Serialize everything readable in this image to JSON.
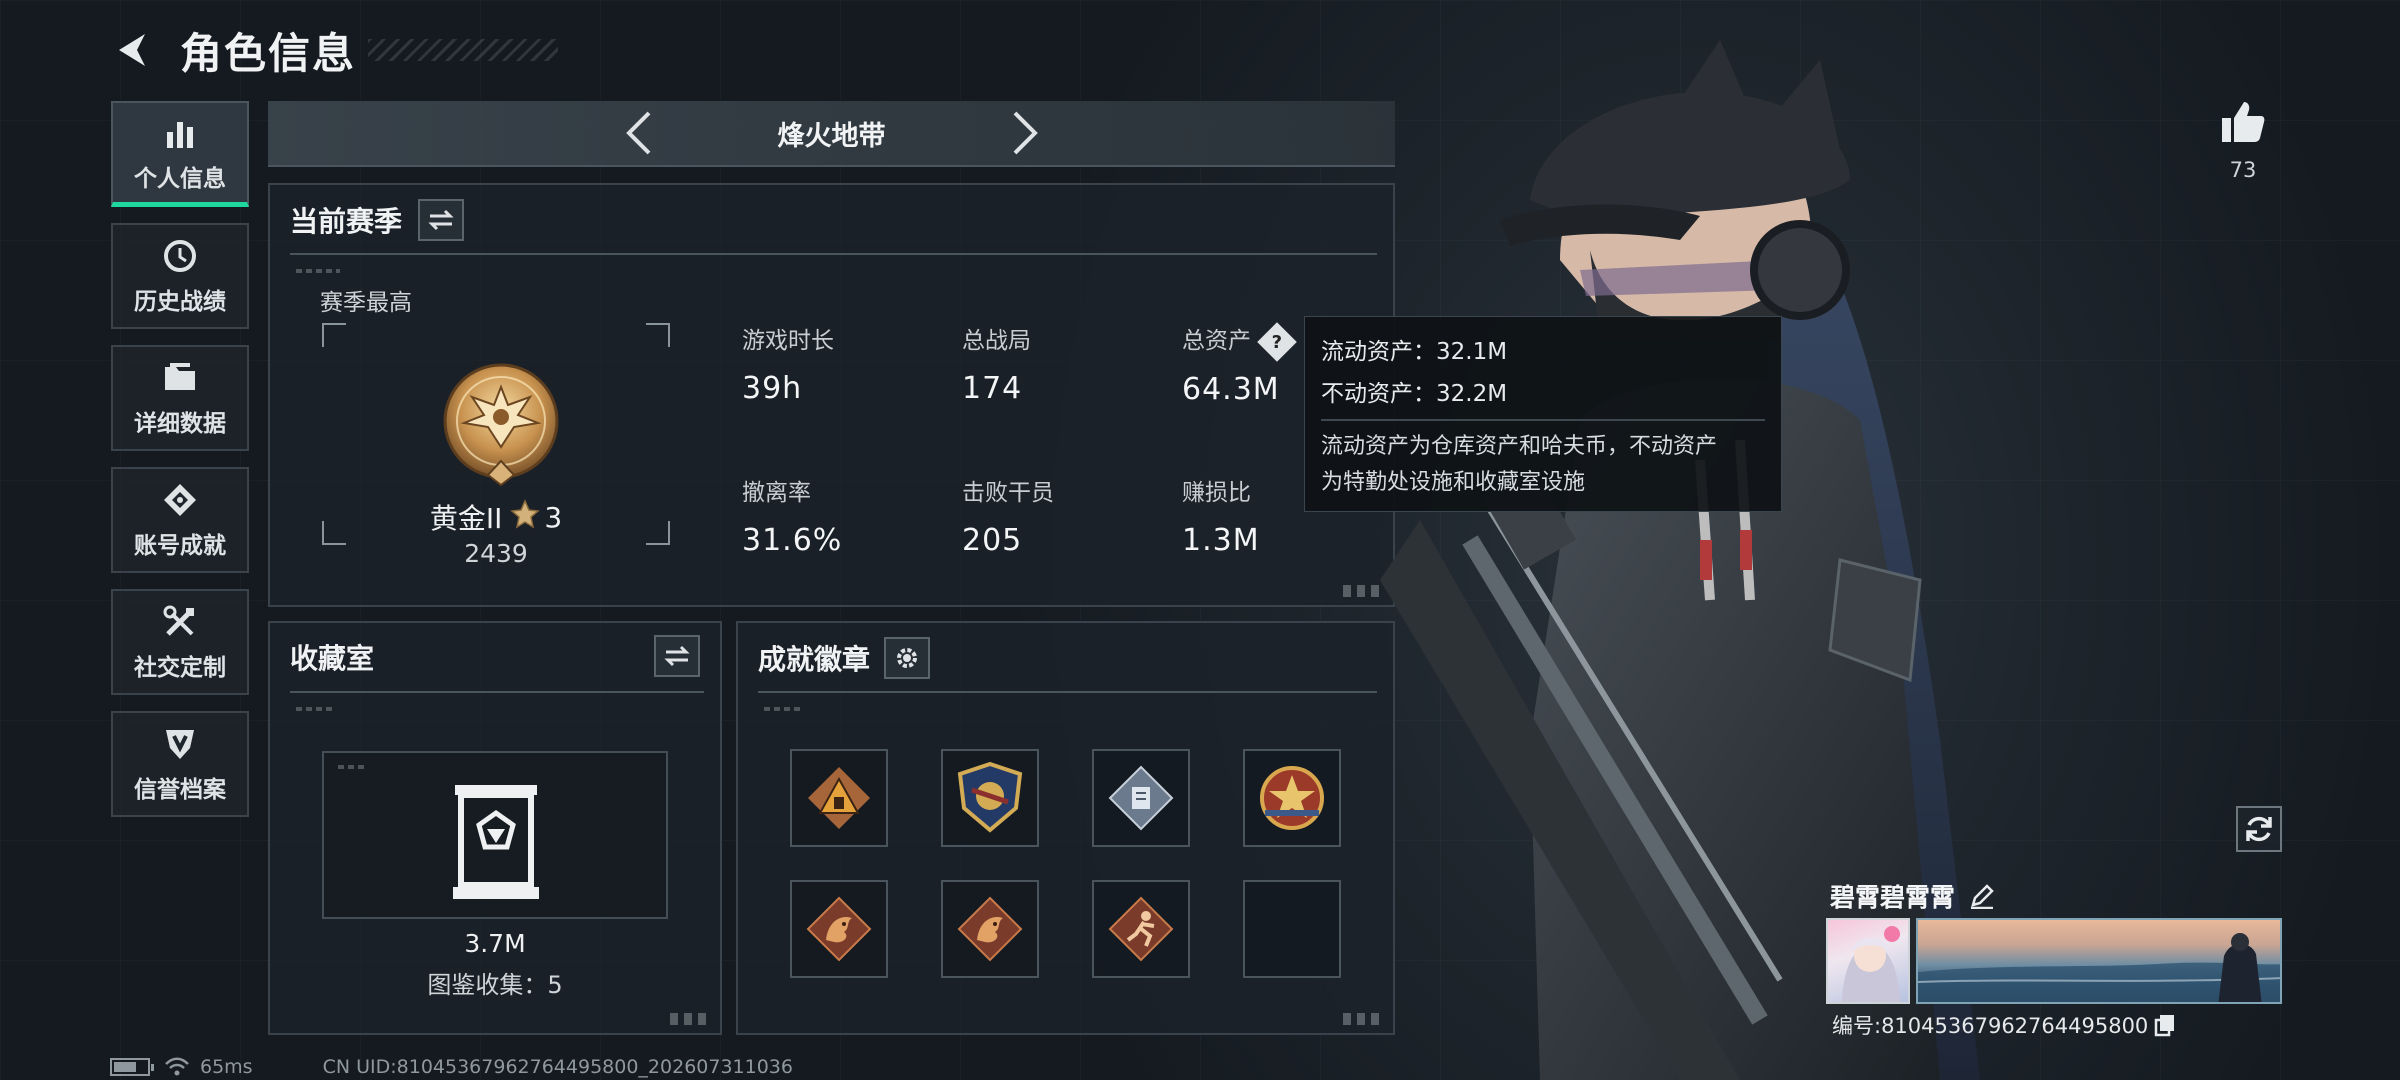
{
  "header": {
    "title": "角色信息"
  },
  "sidebar": {
    "items": [
      {
        "label": "个人信息",
        "icon": "bar-chart-icon",
        "active": true
      },
      {
        "label": "历史战绩",
        "icon": "history-clock-icon"
      },
      {
        "label": "详细数据",
        "icon": "folder-icon"
      },
      {
        "label": "账号成就",
        "icon": "achievement-icon"
      },
      {
        "label": "社交定制",
        "icon": "tools-icon"
      },
      {
        "label": "信誉档案",
        "icon": "shield-emblem-icon"
      }
    ]
  },
  "mode_bar": {
    "name": "烽火地带"
  },
  "season_panel": {
    "title": "当前赛季",
    "best_label": "赛季最高",
    "rank": {
      "name": "黄金II",
      "stars": "3",
      "score": "2439",
      "medal_tier": "II"
    },
    "stats": [
      {
        "label": "游戏时长",
        "value": "39h"
      },
      {
        "label": "总战局",
        "value": "174"
      },
      {
        "label": "总资产",
        "value": "64.3M"
      },
      {
        "label": "撤离率",
        "value": "31.6%"
      },
      {
        "label": "击败干员",
        "value": "205"
      },
      {
        "label": "赚损比",
        "value": "1.3M"
      }
    ]
  },
  "tooltip": {
    "liquid": "流动资产：32.1M",
    "fixed": "不动资产：32.2M",
    "desc_line1": "流动资产为仓库资产和哈夫币，不动资产",
    "desc_line2": "为特勤处设施和收藏室设施"
  },
  "collection_panel": {
    "title": "收藏室",
    "value": "3.7M",
    "count": "图鉴收集：5"
  },
  "badges_panel": {
    "title": "成就徽章",
    "badges": [
      "badge-pyramid-icon",
      "badge-shield-icon",
      "badge-diamond-icon",
      "badge-star-icon",
      "badge-dragon-icon",
      "badge-dragon-icon",
      "badge-runner-icon",
      "empty-slot"
    ]
  },
  "profile": {
    "likes": "73",
    "name": "碧霄碧霄霄",
    "id": "编号:810453679627644958​00"
  },
  "status_bar": {
    "ping": "65ms",
    "uid": "CN UID:810453679627644958​00_202607311036"
  }
}
